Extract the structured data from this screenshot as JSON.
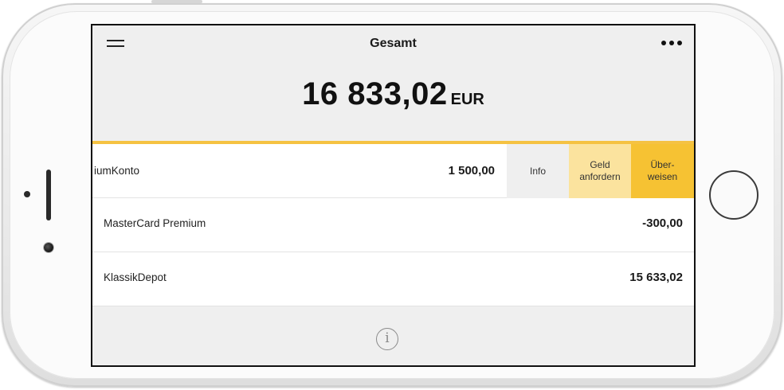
{
  "header": {
    "title": "Gesamt"
  },
  "total": {
    "amount": "16 833,02",
    "currency": "EUR"
  },
  "accounts": [
    {
      "name": "iumKonto",
      "value": "1 500,00"
    },
    {
      "name": "MasterCard Premium",
      "value": "-300,00"
    },
    {
      "name": "KlassikDepot",
      "value": "15 633,02"
    }
  ],
  "swipe_actions": {
    "info": "Info",
    "request_line1": "Geld",
    "request_line2": "anfordern",
    "transfer_line1": "Über-",
    "transfer_line2": "weisen"
  },
  "footer": {
    "info_glyph": "i"
  },
  "icons": {
    "menu": "hamburger-icon",
    "more": "more-dots-icon",
    "info": "info-circle-icon"
  },
  "colors": {
    "accent": "#f5c242",
    "request_bg": "#fbe39e",
    "transfer_bg": "#f6c233",
    "screen_bg": "#efefef"
  }
}
